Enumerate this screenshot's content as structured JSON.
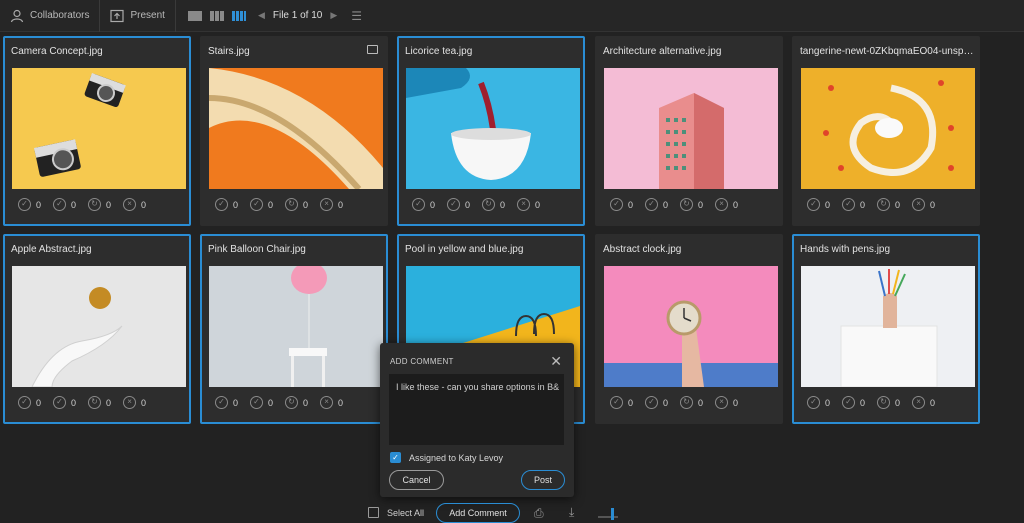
{
  "toolbar": {
    "collaborators": "Collaborators",
    "present": "Present",
    "file_counter": "File 1 of 10",
    "prev_icon": "chevron-left-icon",
    "next_icon": "chevron-right-icon",
    "filter_icon": "filter-icon"
  },
  "action_counts": {
    "approve": "0",
    "add_approver": "0",
    "revision": "0",
    "reject": "0"
  },
  "cards": [
    {
      "title": "Camera Concept.jpg",
      "selected": true
    },
    {
      "title": "Stairs.jpg",
      "selected": false,
      "has_comment": true
    },
    {
      "title": "Licorice tea.jpg",
      "selected": true
    },
    {
      "title": "Architecture alternative.jpg",
      "selected": false
    },
    {
      "title": "tangerine-newt-0ZKbqmaEO04-unspla...",
      "selected": false
    },
    {
      "title": "Apple Abstract.jpg",
      "selected": true
    },
    {
      "title": "Pink Balloon Chair.jpg",
      "selected": true
    },
    {
      "title": "Pool in yellow and blue.jpg",
      "selected": true
    },
    {
      "title": "Abstract clock.jpg",
      "selected": false
    },
    {
      "title": "Hands with pens.jpg",
      "selected": true
    }
  ],
  "modal": {
    "title": "ADD COMMENT",
    "comment_value": "I like these - can you share options in B&",
    "assigned_label": "Assigned to Katy Levoy",
    "cancel": "Cancel",
    "post": "Post"
  },
  "bottom": {
    "select_all": "Select All",
    "add_comment": "Add Comment",
    "print_icon": "print-icon",
    "download_icon": "download-icon"
  },
  "colors": {
    "accent": "#2a8dd4",
    "card_bg": "#2d2d2d",
    "page_bg": "#222222"
  }
}
